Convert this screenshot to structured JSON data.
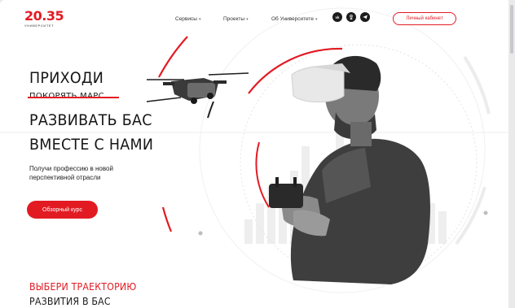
{
  "logo": {
    "number": "20.35",
    "subtitle": "УНИВЕРСИТЕТ"
  },
  "nav": {
    "items": [
      {
        "label": "Сервисы"
      },
      {
        "label": "Проекты"
      },
      {
        "label": "Об Университете"
      }
    ]
  },
  "social": [
    {
      "icon": "vk-icon"
    },
    {
      "icon": "ok-icon"
    },
    {
      "icon": "telegram-icon"
    }
  ],
  "header": {
    "cabinet_label": "Личный кабинет"
  },
  "hero": {
    "line1": "ПРИХОДИ",
    "strikethrough": "ПОКОРЯТЬ МАРС",
    "line2": "РАЗВИВАТЬ БАС",
    "line3": "ВМЕСТЕ С НАМИ",
    "lead_line1": "Получи профессию в новой",
    "lead_line2": "перспективной отрасли",
    "cta_label": "Обзорный курс"
  },
  "section": {
    "title_line1": "ВЫБЕРИ ТРАЕКТОРИЮ",
    "title_line2": "РАЗВИТИЯ В БАС"
  },
  "colors": {
    "accent": "#e21b23",
    "text": "#151515"
  }
}
